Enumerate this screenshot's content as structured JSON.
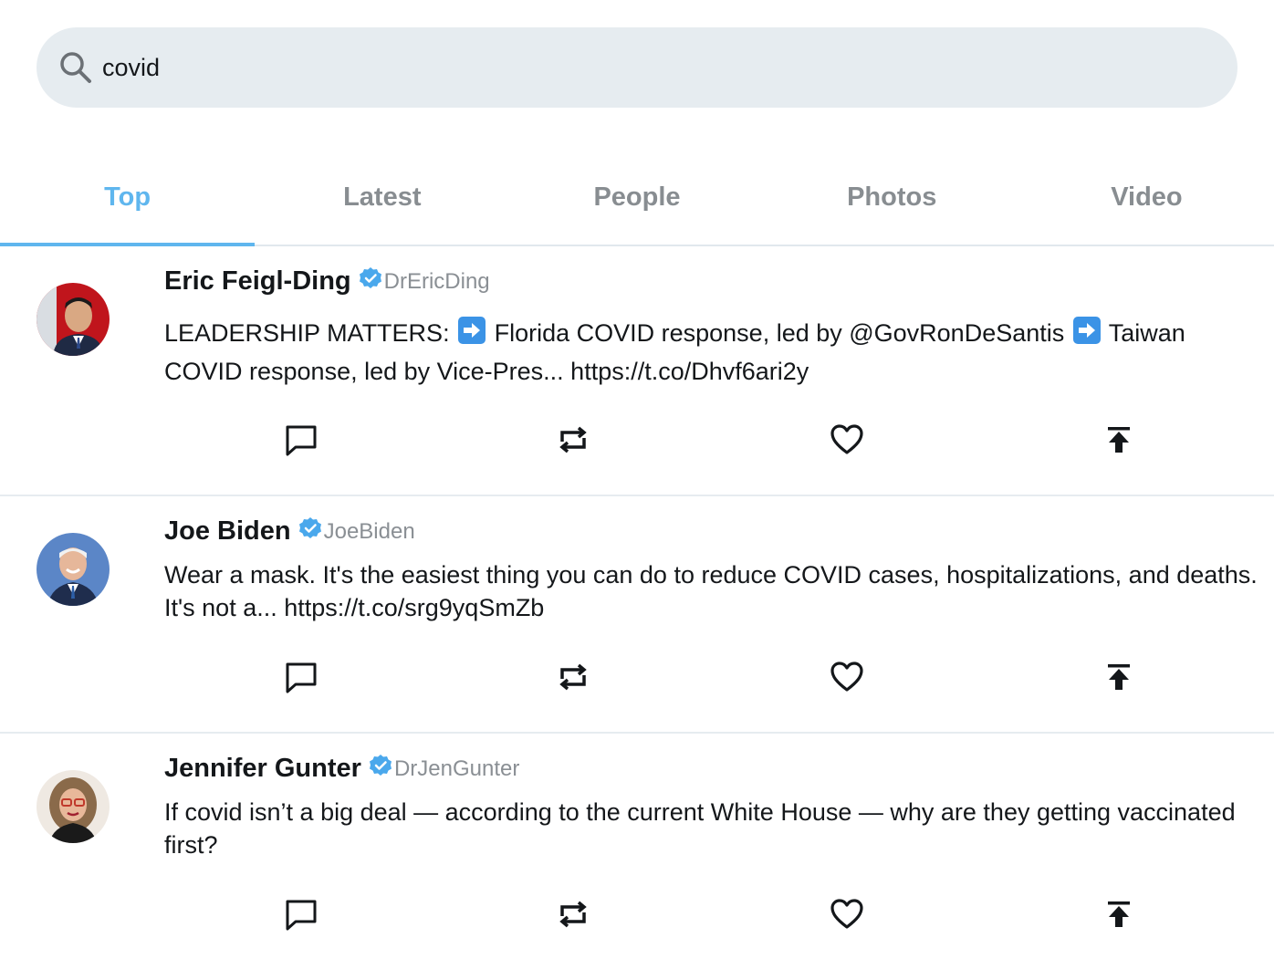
{
  "search": {
    "value": "covid",
    "icon": "search-icon"
  },
  "tabs": [
    {
      "label": "Top",
      "active": true
    },
    {
      "label": "Latest",
      "active": false
    },
    {
      "label": "People",
      "active": false
    },
    {
      "label": "Photos",
      "active": false
    },
    {
      "label": "Video",
      "active": false
    }
  ],
  "colors": {
    "accent": "#5fb6ee",
    "verified": "#4aa8ec",
    "search_bg": "#e6ecf0",
    "muted_text": "#8a8f94"
  },
  "tweets": [
    {
      "name": "Eric Feigl-Ding",
      "handle": "DrEricDing",
      "verified": true,
      "text_part1": "LEADERSHIP MATTERS: ",
      "text_part2": " Florida COVID response, led by @GovRonDeSantis ",
      "text_part3": " Taiwan COVID response, led by Vice-Pres... https://t.co/Dhvf6ari2y"
    },
    {
      "name": "Joe Biden",
      "handle": "JoeBiden",
      "verified": true,
      "text": "Wear a mask. It's the easiest thing you can do to reduce COVID cases, hospitalizations, and deaths. It's not a... https://t.co/srg9yqSmZb"
    },
    {
      "name": "Jennifer Gunter",
      "handle": "DrJenGunter",
      "verified": true,
      "text": "If covid isn’t a big deal — according to the current White House — why are they getting vaccinated first?"
    }
  ],
  "actions": [
    "reply-icon",
    "retweet-icon",
    "like-icon",
    "share-icon"
  ]
}
